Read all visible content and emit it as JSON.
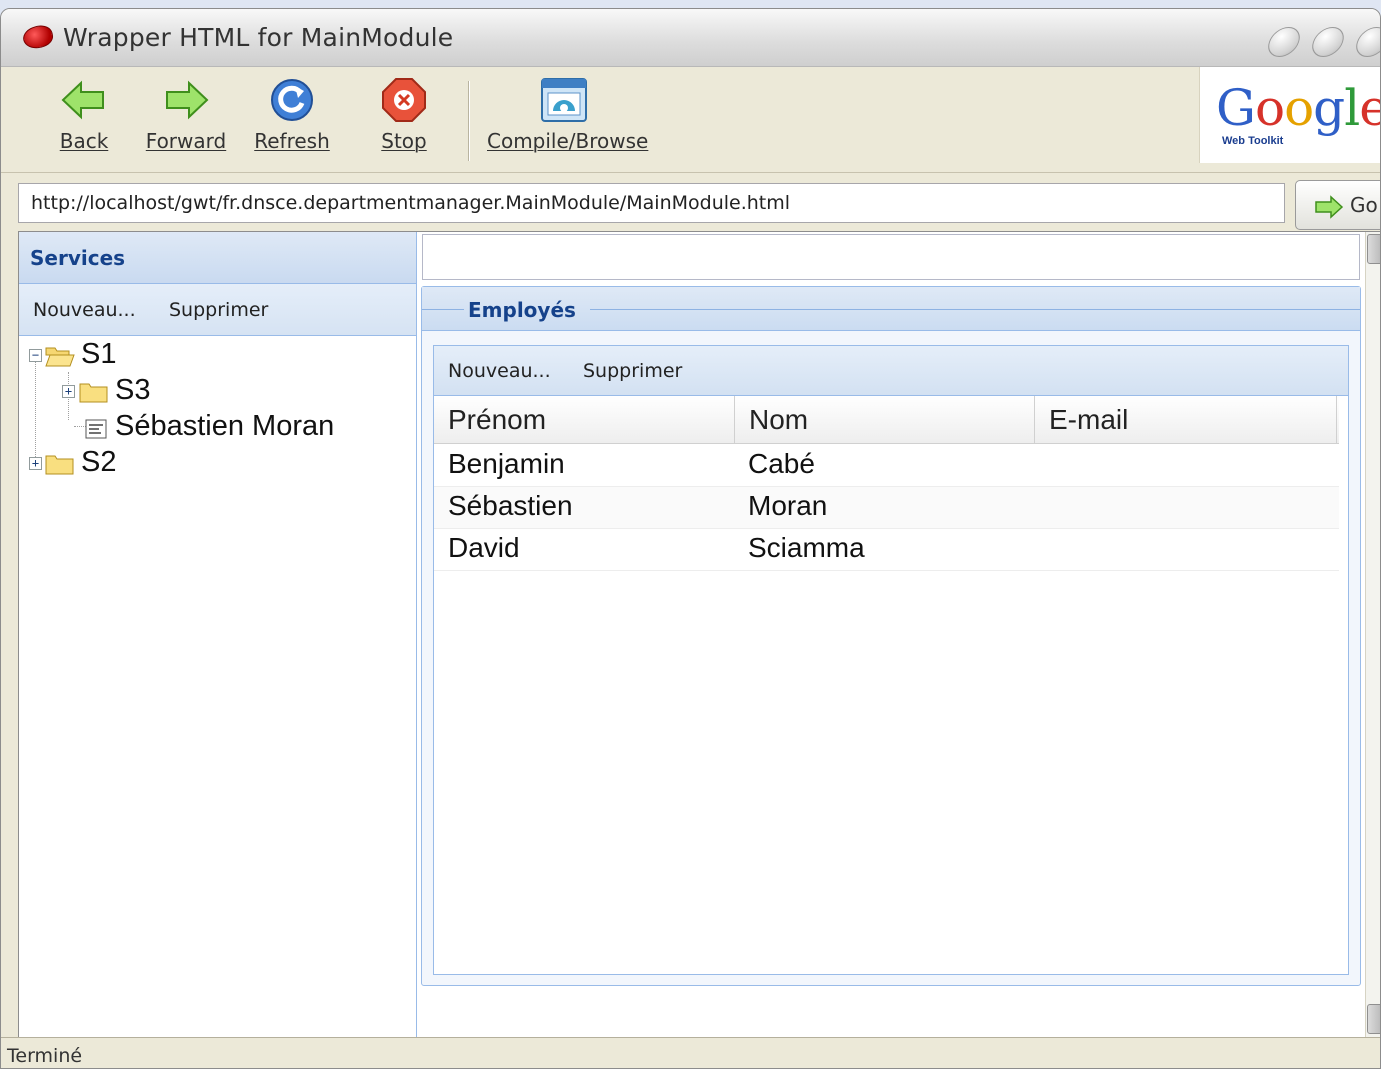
{
  "window": {
    "title": "Wrapper HTML for MainModule"
  },
  "toolbar": {
    "back": "Back",
    "forward": "Forward",
    "refresh": "Refresh",
    "stop": "Stop",
    "compile": "Compile/Browse",
    "logo_text": "Google",
    "logo_sub": "Web Toolkit"
  },
  "address": {
    "url": "http://localhost/gwt/fr.dnsce.departmentmanager.MainModule/MainModule.html",
    "go_label": "Go"
  },
  "services_panel": {
    "title": "Services",
    "new_label": "Nouveau...",
    "delete_label": "Supprimer",
    "tree": [
      {
        "label": "S1",
        "expanded": true,
        "type": "folder"
      },
      {
        "label": "S3",
        "expanded": false,
        "type": "folder"
      },
      {
        "label": "Sébastien Moran",
        "type": "leaf"
      },
      {
        "label": "S2",
        "expanded": false,
        "type": "folder"
      }
    ]
  },
  "employees_panel": {
    "title": "Employés",
    "new_label": "Nouveau...",
    "delete_label": "Supprimer",
    "columns": [
      "Prénom",
      "Nom",
      "E-mail"
    ],
    "rows": [
      {
        "first": "Benjamin",
        "last": "Cabé",
        "email": ""
      },
      {
        "first": "Sébastien",
        "last": "Moran",
        "email": ""
      },
      {
        "first": "David",
        "last": "Sciamma",
        "email": ""
      }
    ]
  },
  "status": {
    "text": "Terminé"
  },
  "colors": {
    "panel_header_text": "#15428b",
    "panel_border": "#99bbe8",
    "chrome_bg": "#ece9d8"
  }
}
